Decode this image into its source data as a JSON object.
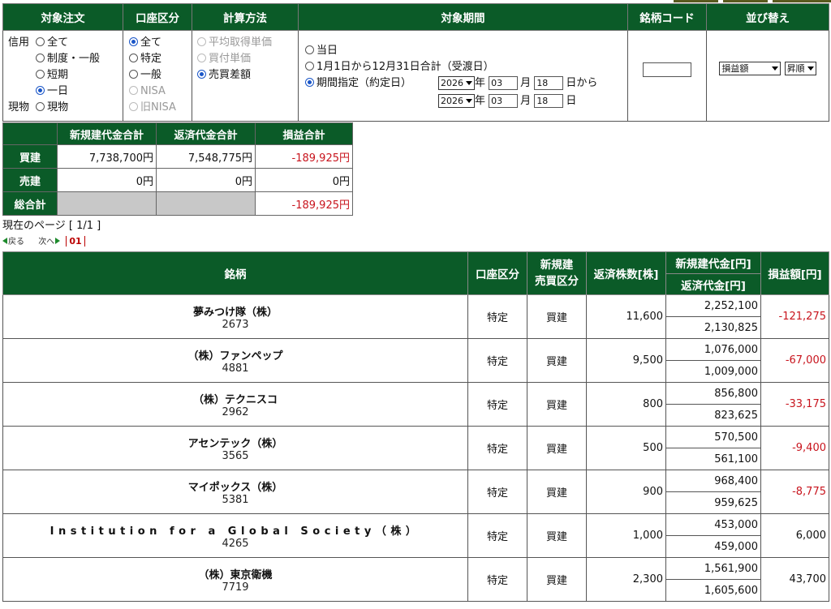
{
  "filter": {
    "headers": [
      "対象注文",
      "口座区分",
      "計算方法",
      "対象期間",
      "銘柄コード",
      "並び替え"
    ],
    "order_type": {
      "credit_label": "信用",
      "credit_options": [
        "全て",
        "制度・一般",
        "短期",
        "一日"
      ],
      "credit_selected": "一日",
      "spot_label": "現物",
      "spot_option": "現物"
    },
    "account": {
      "options": [
        "全て",
        "特定",
        "一般",
        "NISA",
        "旧NISA"
      ],
      "selected": "全て",
      "disabled": [
        "NISA",
        "旧NISA"
      ]
    },
    "calc": {
      "options": [
        "平均取得単価",
        "買付単価",
        "売買差額"
      ],
      "selected": "売買差額",
      "disabled": [
        "平均取得単価",
        "買付単価"
      ]
    },
    "period": {
      "opt_today": "当日",
      "opt_year": "1月1日から12月31日合計（受渡日）",
      "opt_range": "期間指定（約定日）",
      "selected": "期間指定（約定日）",
      "from": {
        "year": "2026",
        "month": "03",
        "day": "18"
      },
      "to": {
        "year": "2026",
        "month": "03",
        "day": "18"
      },
      "label_year": "年",
      "label_month": "月",
      "label_from": "日から",
      "label_to": "日"
    },
    "code_value": "",
    "sort": {
      "field": "損益額",
      "order": "昇順"
    }
  },
  "summary": {
    "headers": [
      "新規建代金合計",
      "返済代金合計",
      "損益合計"
    ],
    "rows": [
      {
        "label": "買建",
        "open": "7,738,700円",
        "close": "7,548,775円",
        "pl": "-189,925円",
        "pl_neg": true
      },
      {
        "label": "売建",
        "open": "0円",
        "close": "0円",
        "pl": "0円",
        "pl_neg": false
      }
    ],
    "total_label": "総合計",
    "total_pl": "-189,925円"
  },
  "paging": {
    "info": "現在のページ [ 1/1 ]",
    "back": "戻る",
    "next": "次へ",
    "page": "01"
  },
  "table": {
    "headers": {
      "name": "銘柄",
      "account": "口座区分",
      "trade_1": "新規建",
      "trade_2": "売買区分",
      "qty": "返済株数[株]",
      "open_amt": "新規建代金[円]",
      "close_amt": "返済代金[円]",
      "pl": "損益額[円]"
    },
    "rows": [
      {
        "name": "夢みつけ隊（株）",
        "code": "2673",
        "account": "特定",
        "trade": "買建",
        "qty": "11,600",
        "open": "2,252,100",
        "close": "2,130,825",
        "pl": "-121,275",
        "neg": true
      },
      {
        "name": "（株）ファンペップ",
        "code": "4881",
        "account": "特定",
        "trade": "買建",
        "qty": "9,500",
        "open": "1,076,000",
        "close": "1,009,000",
        "pl": "-67,000",
        "neg": true
      },
      {
        "name": "（株）テクニスコ",
        "code": "2962",
        "account": "特定",
        "trade": "買建",
        "qty": "800",
        "open": "856,800",
        "close": "823,625",
        "pl": "-33,175",
        "neg": true
      },
      {
        "name": "アセンテック（株）",
        "code": "3565",
        "account": "特定",
        "trade": "買建",
        "qty": "500",
        "open": "570,500",
        "close": "561,100",
        "pl": "-9,400",
        "neg": true
      },
      {
        "name": "マイポックス（株）",
        "code": "5381",
        "account": "特定",
        "trade": "買建",
        "qty": "900",
        "open": "968,400",
        "close": "959,625",
        "pl": "-8,775",
        "neg": true
      },
      {
        "name": "Institution for a Global Society（株）",
        "code": "4265",
        "account": "特定",
        "trade": "買建",
        "qty": "1,000",
        "open": "453,000",
        "close": "459,000",
        "pl": "6,000",
        "neg": false
      },
      {
        "name": "（株）東京衛機",
        "code": "7719",
        "account": "特定",
        "trade": "買建",
        "qty": "2,300",
        "open": "1,561,900",
        "close": "1,605,600",
        "pl": "43,700",
        "neg": false
      }
    ]
  }
}
